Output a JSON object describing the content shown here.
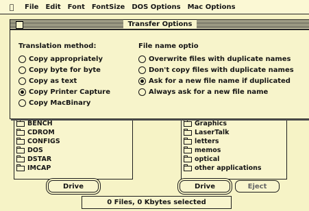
{
  "menubar": {
    "apple": "",
    "items": [
      "File",
      "Edit",
      "Font",
      "FontSize",
      "DOS Options",
      "Mac Options"
    ]
  },
  "window": {
    "title": "Transfer Options"
  },
  "translation": {
    "heading": "Translation method:",
    "options": [
      {
        "label": "Copy appropriately",
        "selected": false
      },
      {
        "label": "Copy byte for byte",
        "selected": false
      },
      {
        "label": "Copy as text",
        "selected": false
      },
      {
        "label": "Copy Printer Capture",
        "selected": true
      },
      {
        "label": "Copy MacBinary",
        "selected": false
      }
    ]
  },
  "file_name": {
    "heading": "File name optio",
    "options": [
      {
        "label": "Overwrite files with duplicate names",
        "selected": false
      },
      {
        "label": "Don't copy files with duplicate names",
        "selected": false
      },
      {
        "label": "Ask for a new file name if duplicated",
        "selected": true
      },
      {
        "label": "Always ask for a new file name",
        "selected": false
      }
    ]
  },
  "left_list": {
    "items": [
      "BENCH",
      "CDROM",
      "CONFIGS",
      "DOS",
      "DSTAR",
      "IMCAP"
    ]
  },
  "right_list": {
    "items": [
      "Graphics",
      "LaserTalk",
      "letters",
      "memos",
      "optical",
      "other applications"
    ]
  },
  "buttons": {
    "drive_left": "Drive",
    "drive_right": "Drive",
    "eject": "Eject"
  },
  "status": {
    "text": "0 Files, 0 Kbytes selected"
  }
}
